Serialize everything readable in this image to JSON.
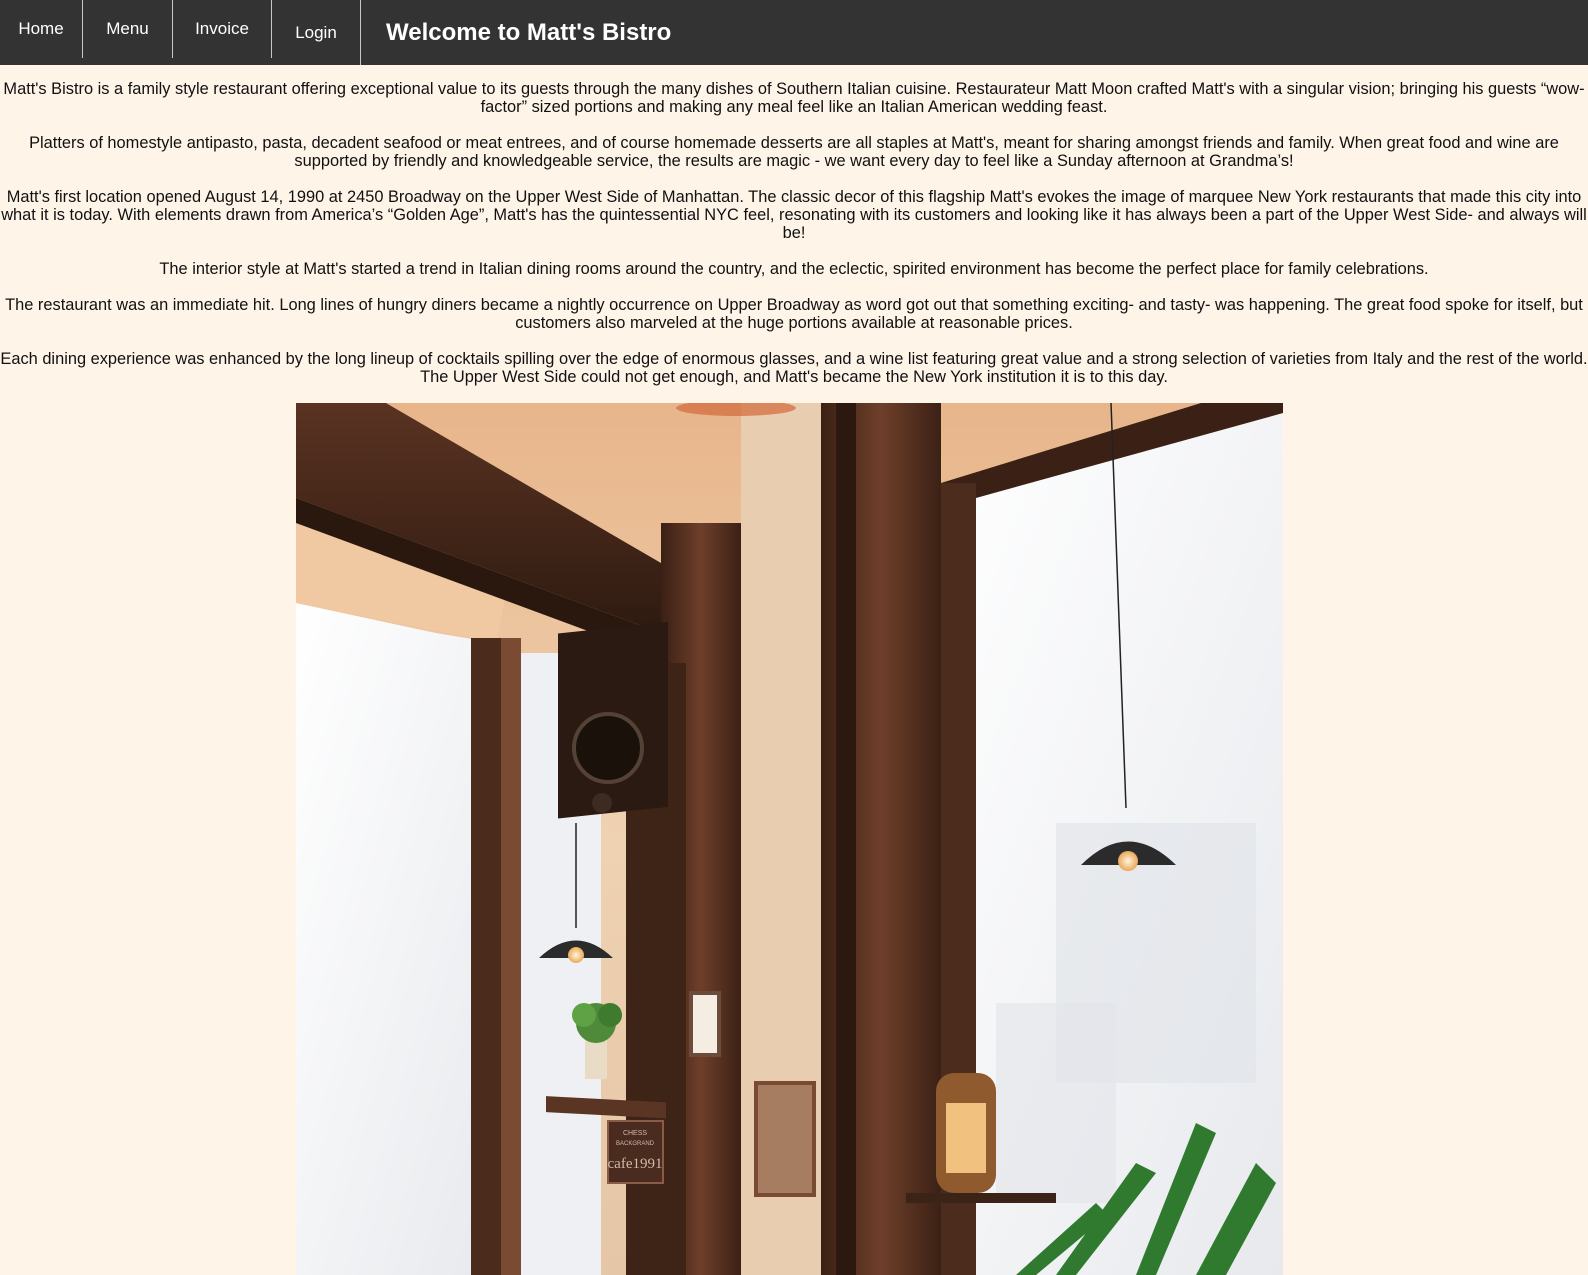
{
  "nav": {
    "items": [
      {
        "label": "Home"
      },
      {
        "label": "Menu"
      },
      {
        "label": "Invoice"
      },
      {
        "label": "Login"
      }
    ],
    "title": "Welcome to Matt's Bistro"
  },
  "content": {
    "paragraphs": [
      "Matt's Bistro is a family style restaurant offering exceptional value to its guests through the many dishes of Southern Italian cuisine. Restaurateur Matt Moon crafted Matt's with a singular vision; bringing his guests “wow-factor” sized portions and making any meal feel like an Italian American wedding feast.",
      "Platters of homestyle antipasto, pasta, decadent seafood or meat entrees, and of course homemade desserts are all staples at Matt's, meant for sharing amongst friends and family. When great food and wine are supported by friendly and knowledgeable service, the results are magic - we want every day to feel like a Sunday afternoon at Grandma’s!",
      "Matt's first location opened August 14, 1990 at 2450 Broadway on the Upper West Side of Manhattan. The classic decor of this flagship Matt's evokes the image of marquee New York restaurants that made this city into what it is today. With elements drawn from America’s “Golden Age”, Matt's has the quintessential NYC feel, resonating with its customers and looking like it has always been a part of the Upper West Side- and always will be!",
      "The interior style at Matt's started a trend in Italian dining rooms around the country, and the eclectic, spirited environment has become the perfect place for family celebrations.",
      "The restaurant was an immediate hit. Long lines of hungry diners became a nightly occurrence on Upper Broadway as word got out that something exciting- and tasty- was happening. The great food spoke for itself, but customers also marveled at the huge portions available at reasonable prices.",
      "Each dining experience was enhanced by the long lineup of cocktails spilling over the edge of enormous glasses, and a wine list featuring great value and a strong selection of varieties from Italy and the rest of the world. The Upper West Side could not get enough, and Matt's became the New York institution it is to this day."
    ],
    "photo": {
      "sign_line1": "CHESS",
      "sign_line2": "BACKGRAND",
      "sign_line3": "cafe1991"
    }
  },
  "colors": {
    "navbar_bg": "#333333",
    "page_bg": "#fff4e8",
    "wood_dark": "#4a2a1a",
    "window_light": "#f3f4f6"
  }
}
